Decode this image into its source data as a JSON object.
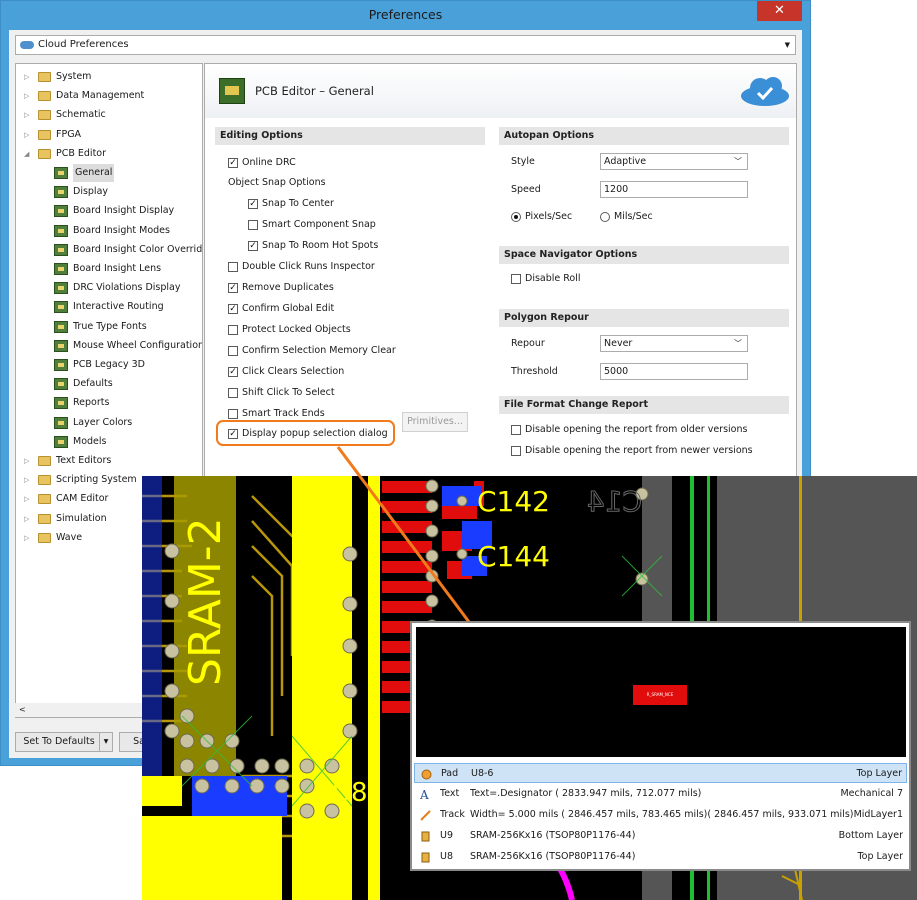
{
  "window": {
    "title": "Preferences",
    "close": "✕"
  },
  "cloud_bar": {
    "label": "Cloud Preferences"
  },
  "tree": [
    {
      "label": "System",
      "kind": "folder",
      "level": 0,
      "expander": "▷"
    },
    {
      "label": "Data Management",
      "kind": "folder",
      "level": 0,
      "expander": "▷"
    },
    {
      "label": "Schematic",
      "kind": "folder",
      "level": 0,
      "expander": "▷"
    },
    {
      "label": "FPGA",
      "kind": "folder",
      "level": 0,
      "expander": "▷"
    },
    {
      "label": "PCB Editor",
      "kind": "folder",
      "level": 0,
      "expander": "◢"
    },
    {
      "label": "General",
      "kind": "page",
      "level": 1,
      "selected": true
    },
    {
      "label": "Display",
      "kind": "page",
      "level": 1
    },
    {
      "label": "Board Insight Display",
      "kind": "page",
      "level": 1
    },
    {
      "label": "Board Insight Modes",
      "kind": "page",
      "level": 1
    },
    {
      "label": "Board Insight Color Overrid",
      "kind": "page",
      "level": 1
    },
    {
      "label": "Board Insight Lens",
      "kind": "page",
      "level": 1
    },
    {
      "label": "DRC Violations Display",
      "kind": "page",
      "level": 1
    },
    {
      "label": "Interactive Routing",
      "kind": "page",
      "level": 1
    },
    {
      "label": "True Type Fonts",
      "kind": "page",
      "level": 1
    },
    {
      "label": "Mouse Wheel Configuration",
      "kind": "page",
      "level": 1
    },
    {
      "label": "PCB Legacy 3D",
      "kind": "page",
      "level": 1
    },
    {
      "label": "Defaults",
      "kind": "page",
      "level": 1
    },
    {
      "label": "Reports",
      "kind": "page",
      "level": 1
    },
    {
      "label": "Layer Colors",
      "kind": "page",
      "level": 1
    },
    {
      "label": "Models",
      "kind": "page",
      "level": 1
    },
    {
      "label": "Text Editors",
      "kind": "folder",
      "level": 0,
      "expander": "▷"
    },
    {
      "label": "Scripting System",
      "kind": "folder",
      "level": 0,
      "expander": "▷"
    },
    {
      "label": "CAM Editor",
      "kind": "folder",
      "level": 0,
      "expander": "▷"
    },
    {
      "label": "Simulation",
      "kind": "folder",
      "level": 0,
      "expander": "▷"
    },
    {
      "label": "Wave",
      "kind": "folder",
      "level": 0,
      "expander": "▷"
    }
  ],
  "scroll_left": "<",
  "buttons": {
    "set_defaults": "Set To Defaults",
    "set_defaults_arrow": "▾",
    "save": "Sa",
    "primitives": "Primitives..."
  },
  "panel": {
    "title": "PCB Editor – General"
  },
  "editing": {
    "header": "Editing Options",
    "online_drc": {
      "label": "Online DRC",
      "checked": true
    },
    "object_snap_label": "Object Snap Options",
    "snap_to_center": {
      "label": "Snap To Center",
      "checked": true
    },
    "smart_component_snap": {
      "label": "Smart Component Snap",
      "checked": false
    },
    "snap_to_room": {
      "label": "Snap To Room Hot Spots",
      "checked": true
    },
    "double_click": {
      "label": "Double Click Runs Inspector",
      "checked": false
    },
    "remove_duplicates": {
      "label": "Remove Duplicates",
      "checked": true
    },
    "confirm_global": {
      "label": "Confirm Global Edit",
      "checked": true
    },
    "protect_locked": {
      "label": "Protect Locked Objects",
      "checked": false
    },
    "confirm_selection": {
      "label": "Confirm Selection Memory Clear",
      "checked": false
    },
    "click_clears": {
      "label": "Click Clears Selection",
      "checked": true
    },
    "shift_click": {
      "label": "Shift Click To Select",
      "checked": false
    },
    "smart_track": {
      "label": "Smart Track Ends",
      "checked": false
    },
    "display_popup": {
      "label": "Display popup selection dialog",
      "checked": true
    }
  },
  "autopan": {
    "header": "Autopan Options",
    "style_label": "Style",
    "style_value": "Adaptive",
    "speed_label": "Speed",
    "speed_value": "1200",
    "pixels": "Pixels/Sec",
    "mils": "Mils/Sec"
  },
  "space_nav": {
    "header": "Space Navigator Options",
    "disable_roll": "Disable Roll"
  },
  "polygon": {
    "header": "Polygon Repour",
    "repour_label": "Repour",
    "repour_value": "Never",
    "threshold_label": "Threshold",
    "threshold_value": "5000"
  },
  "file_format": {
    "header": "File Format Change Report",
    "older": "Disable opening the report from older versions",
    "newer": "Disable opening the report from newer versions"
  },
  "pcb_labels": {
    "c142": "C142",
    "c144": "C144",
    "c14x": "C14",
    "sram": "SRAM-2",
    "u8": "U8"
  },
  "popup": {
    "pad_label": "R_SRAM_NCE",
    "rows": [
      {
        "c1": "Pad",
        "c2": "U8-6",
        "c3": "Top Layer",
        "icon": "pad-icon"
      },
      {
        "c1": "Text",
        "c2": "Text=.Designator ( 2833.947 mils,   712.077 mils)",
        "c3": "Mechanical 7",
        "icon": "text-icon"
      },
      {
        "c1": "Track",
        "c2": "Width=    5.000 mils ( 2846.457 mils,  783.465 mils)( 2846.457 mils,   933.071 mils)",
        "c3": "MidLayer1",
        "icon": "track-icon"
      },
      {
        "c1": "U9",
        "c2": "SRAM-256Kx16 (TSOP80P1176-44)",
        "c3": "Bottom Layer",
        "icon": "component-icon"
      },
      {
        "c1": "U8",
        "c2": "SRAM-256Kx16 (TSOP80P1176-44)",
        "c3": "Top Layer",
        "icon": "component-icon"
      }
    ]
  },
  "colors": {
    "accent": "#f07a1c",
    "pcb_yellow": "#ffff00",
    "pcb_red": "#e10d0d",
    "pcb_blue": "#1a3cff",
    "title_bar": "#4aa0d8"
  }
}
